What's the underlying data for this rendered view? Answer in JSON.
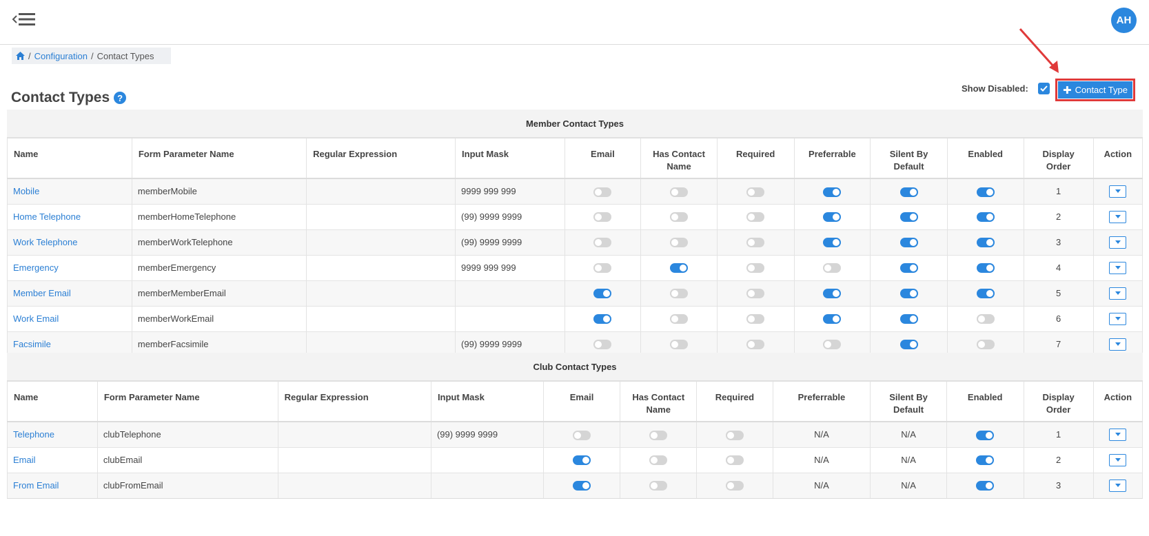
{
  "topbar": {
    "avatar_initials": "AH"
  },
  "breadcrumb": {
    "configuration": "Configuration",
    "current": "Contact Types",
    "sep": "/"
  },
  "page": {
    "title": "Contact Types",
    "help": "?"
  },
  "controls": {
    "show_disabled_label": "Show Disabled:",
    "show_disabled_checked": true,
    "add_button_label": "Contact Type"
  },
  "colors": {
    "accent": "#2b87de",
    "highlight": "#e03a3a",
    "link": "#2b7fd4"
  },
  "member": {
    "title": "Member Contact Types",
    "headers": {
      "name": "Name",
      "form_param": "Form Parameter Name",
      "regex": "Regular Expression",
      "input_mask": "Input Mask",
      "email": "Email",
      "has_contact_name_1": "Has Contact",
      "has_contact_name_2": "Name",
      "required": "Required",
      "preferrable": "Preferrable",
      "silent_1": "Silent By",
      "silent_2": "Default",
      "enabled": "Enabled",
      "display_order_1": "Display",
      "display_order_2": "Order",
      "action": "Action"
    },
    "rows": [
      {
        "name": "Mobile",
        "param": "memberMobile",
        "regex": "",
        "mask": "9999 999 999",
        "email": false,
        "has_contact": false,
        "required": false,
        "preferrable": true,
        "silent": true,
        "enabled": true,
        "order": "1"
      },
      {
        "name": "Home Telephone",
        "param": "memberHomeTelephone",
        "regex": "",
        "mask": "(99) 9999 9999",
        "email": false,
        "has_contact": false,
        "required": false,
        "preferrable": true,
        "silent": true,
        "enabled": true,
        "order": "2"
      },
      {
        "name": "Work Telephone",
        "param": "memberWorkTelephone",
        "regex": "",
        "mask": "(99) 9999 9999",
        "email": false,
        "has_contact": false,
        "required": false,
        "preferrable": true,
        "silent": true,
        "enabled": true,
        "order": "3"
      },
      {
        "name": "Emergency",
        "param": "memberEmergency",
        "regex": "",
        "mask": "9999 999 999",
        "email": false,
        "has_contact": true,
        "required": false,
        "preferrable": false,
        "silent": true,
        "enabled": true,
        "order": "4"
      },
      {
        "name": "Member Email",
        "param": "memberMemberEmail",
        "regex": "",
        "mask": "",
        "email": true,
        "has_contact": false,
        "required": false,
        "preferrable": true,
        "silent": true,
        "enabled": true,
        "order": "5"
      },
      {
        "name": "Work Email",
        "param": "memberWorkEmail",
        "regex": "",
        "mask": "",
        "email": true,
        "has_contact": false,
        "required": false,
        "preferrable": true,
        "silent": true,
        "enabled": false,
        "order": "6"
      },
      {
        "name": "Facsimile",
        "param": "memberFacsimile",
        "regex": "",
        "mask": "(99) 9999 9999",
        "email": false,
        "has_contact": false,
        "required": false,
        "preferrable": false,
        "silent": true,
        "enabled": false,
        "order": "7"
      }
    ]
  },
  "club": {
    "title": "Club Contact Types",
    "rows": [
      {
        "name": "Telephone",
        "param": "clubTelephone",
        "regex": "",
        "mask": "(99) 9999 9999",
        "email": false,
        "has_contact": false,
        "required": false,
        "preferrable": "N/A",
        "silent": "N/A",
        "enabled": true,
        "order": "1"
      },
      {
        "name": "Email",
        "param": "clubEmail",
        "regex": "",
        "mask": "",
        "email": true,
        "has_contact": false,
        "required": false,
        "preferrable": "N/A",
        "silent": "N/A",
        "enabled": true,
        "order": "2"
      },
      {
        "name": "From Email",
        "param": "clubFromEmail",
        "regex": "",
        "mask": "",
        "email": true,
        "has_contact": false,
        "required": false,
        "preferrable": "N/A",
        "silent": "N/A",
        "enabled": true,
        "order": "3"
      }
    ]
  }
}
